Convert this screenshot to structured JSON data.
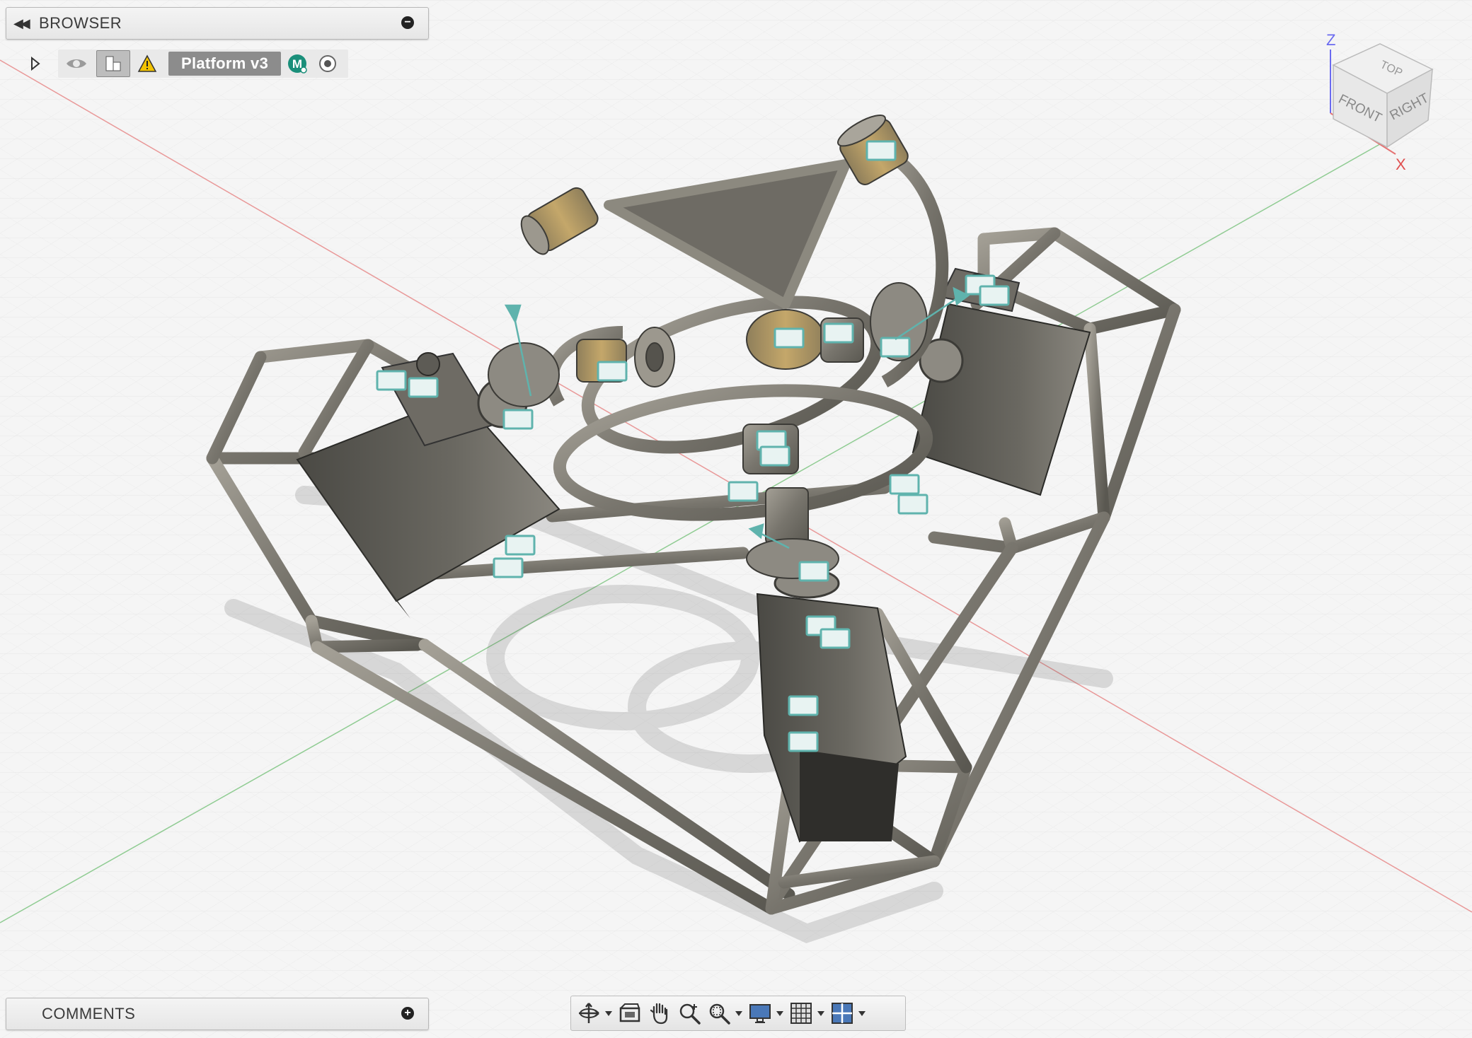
{
  "browser": {
    "title": "BROWSER",
    "collapse_icon": "double-chevron-left-icon",
    "pill_icon": "minus-circle-icon"
  },
  "tree": {
    "component_name": "Platform v3",
    "motion_badge": "M",
    "warning_color": "#f2c200",
    "badge_color": "#1a8f7a"
  },
  "comments": {
    "title": "COMMENTS",
    "pill_icon": "plus-circle-icon"
  },
  "viewcube": {
    "top_label": "TOP",
    "front_label": "FRONT",
    "right_label": "RIGHT",
    "axis_z": "Z",
    "axis_x": "X"
  },
  "toolbar": {
    "tools": [
      "orbit-icon",
      "look-at-icon",
      "pan-icon",
      "zoom-icon",
      "zoom-window-icon",
      "display-settings-icon",
      "grid-icon",
      "viewports-icon"
    ]
  },
  "colors": {
    "axis_red": "#e57373",
    "axis_green": "#66bb6a",
    "model_metal": "#7d7a72",
    "joint_teal": "#5fb3ad",
    "viewport_bg": "#f5f5f5"
  }
}
